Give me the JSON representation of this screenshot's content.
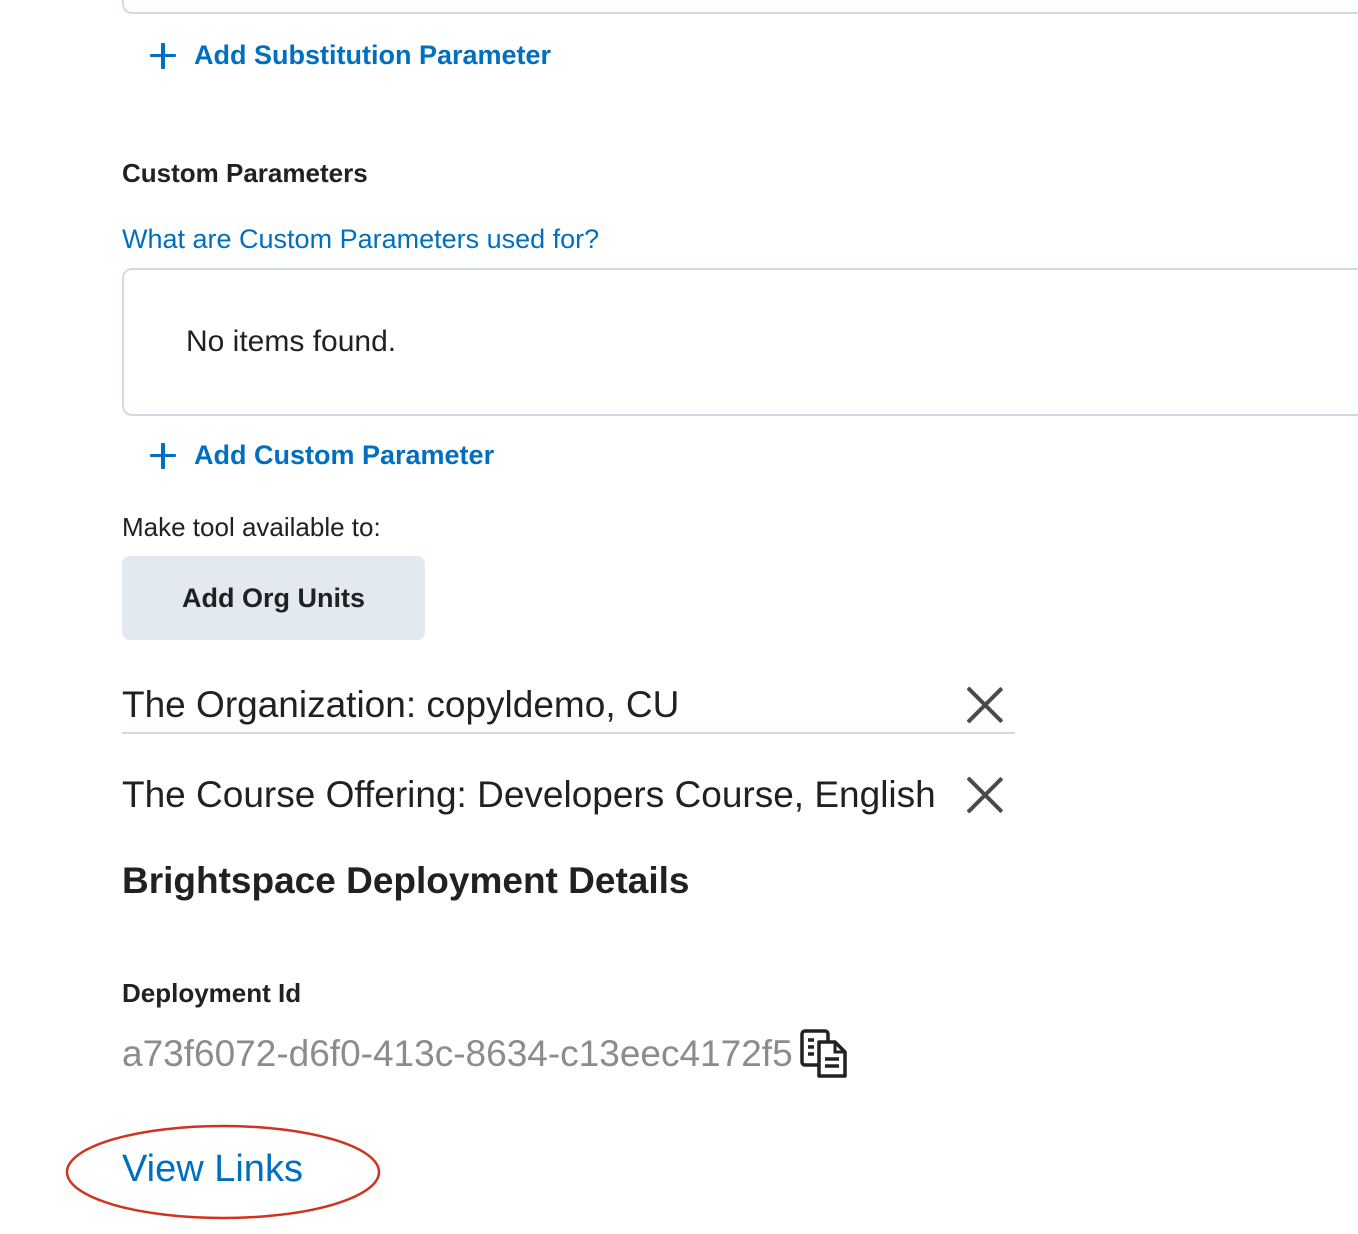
{
  "substitution": {
    "add_label": "Add Substitution Parameter"
  },
  "custom_parameters": {
    "heading": "Custom Parameters",
    "help_link": "What are Custom Parameters used for?",
    "empty_text": "No items found.",
    "add_label": "Add Custom Parameter"
  },
  "availability": {
    "label": "Make tool available to:",
    "button_label": "Add Org Units",
    "org_units": [
      {
        "label": "The Organization: copyldemo, CU"
      },
      {
        "label": "The Course Offering: Developers Course, English"
      }
    ]
  },
  "deployment": {
    "heading": "Brightspace Deployment Details",
    "id_label": "Deployment Id",
    "id_value": "a73f6072-d6f0-413c-8634-c13eec4172f5"
  },
  "links": {
    "view_links": "View Links"
  },
  "colors": {
    "link": "#006fbf",
    "button_bg": "#e3e9f1",
    "muted_text": "#8a8c8e",
    "annotation": "#d0331f"
  },
  "icons": [
    "plus-icon",
    "close-icon",
    "copy-icon"
  ]
}
